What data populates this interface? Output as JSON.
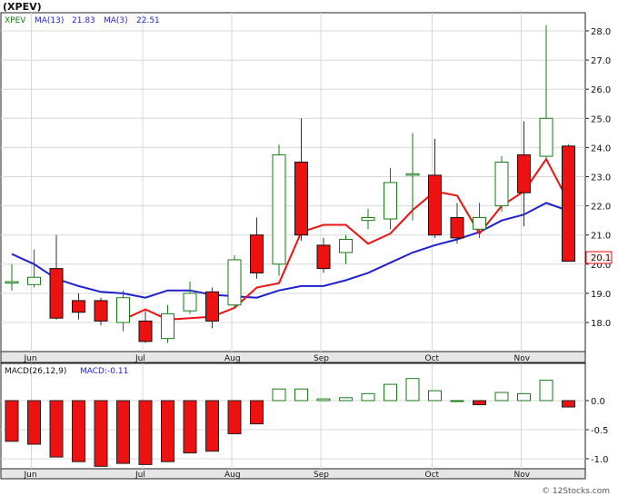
{
  "ticker_title": "(XPEV)",
  "legend": {
    "symbol": "XPEV",
    "ma13_label": "MA(13)",
    "ma13_value": "21.83",
    "ma3_label": "MA(3)",
    "ma3_value": "22.51",
    "macd_label": "MACD(26,12,9)",
    "macd_value_label": "MACD:-0.11"
  },
  "last_price_label": "20.1",
  "watermark": "© 12Stocks.com",
  "colors": {
    "up_body": "#ffffff",
    "up_outline": "#1a7a1a",
    "down_body": "#ee1111",
    "down_outline": "#111111",
    "wick": "#333333",
    "ma13": "#1f1fcf",
    "ma3": "#ee1111",
    "grid": "#d8d8d8",
    "frame": "#222222",
    "hist_pos_outline": "#1a7a1a",
    "hist_neg": "#ee1111",
    "price_box": "#ffeeee"
  },
  "chart_data": [
    {
      "type": "candlestick",
      "title": "(XPEV)",
      "x_labels": [
        "Jun",
        "Jul",
        "Aug",
        "Sep",
        "Oct",
        "Nov"
      ],
      "y_ticks": [
        "18.0",
        "19.0",
        "20.0",
        "21.0",
        "22.0",
        "23.0",
        "24.0",
        "25.0",
        "26.0",
        "27.0",
        "28.0"
      ],
      "ylim": [
        17.0,
        28.5
      ],
      "grid": true,
      "periods": 26,
      "month_starts": [
        1,
        6,
        10,
        14,
        19,
        23
      ],
      "candles": [
        {
          "o": 19.35,
          "h": 20.0,
          "l": 19.1,
          "c": 19.4
        },
        {
          "o": 19.3,
          "h": 20.5,
          "l": 19.2,
          "c": 19.55
        },
        {
          "o": 19.85,
          "h": 21.0,
          "l": 18.1,
          "c": 18.15
        },
        {
          "o": 18.75,
          "h": 19.0,
          "l": 18.1,
          "c": 18.35
        },
        {
          "o": 18.75,
          "h": 18.85,
          "l": 17.9,
          "c": 18.05
        },
        {
          "o": 18.0,
          "h": 19.1,
          "l": 17.7,
          "c": 18.85
        },
        {
          "o": 18.05,
          "h": 18.4,
          "l": 17.3,
          "c": 17.35
        },
        {
          "o": 17.45,
          "h": 18.6,
          "l": 17.3,
          "c": 18.3
        },
        {
          "o": 18.4,
          "h": 19.4,
          "l": 18.3,
          "c": 19.0
        },
        {
          "o": 19.05,
          "h": 19.2,
          "l": 17.8,
          "c": 18.05
        },
        {
          "o": 18.6,
          "h": 20.3,
          "l": 18.5,
          "c": 20.15
        },
        {
          "o": 21.0,
          "h": 21.6,
          "l": 19.5,
          "c": 19.7
        },
        {
          "o": 20.0,
          "h": 24.1,
          "l": 19.6,
          "c": 23.75
        },
        {
          "o": 23.5,
          "h": 25.0,
          "l": 20.8,
          "c": 21.0
        },
        {
          "o": 20.65,
          "h": 20.9,
          "l": 19.7,
          "c": 19.85
        },
        {
          "o": 20.4,
          "h": 21.0,
          "l": 20.0,
          "c": 20.85
        },
        {
          "o": 21.5,
          "h": 21.9,
          "l": 21.2,
          "c": 21.6
        },
        {
          "o": 21.55,
          "h": 23.3,
          "l": 21.2,
          "c": 22.8
        },
        {
          "o": 23.05,
          "h": 24.5,
          "l": 21.5,
          "c": 23.1
        },
        {
          "o": 23.05,
          "h": 24.3,
          "l": 20.9,
          "c": 21.0
        },
        {
          "o": 21.6,
          "h": 22.1,
          "l": 20.7,
          "c": 20.9
        },
        {
          "o": 21.2,
          "h": 22.1,
          "l": 20.9,
          "c": 21.6
        },
        {
          "o": 22.0,
          "h": 23.7,
          "l": 21.8,
          "c": 23.5
        },
        {
          "o": 23.75,
          "h": 24.9,
          "l": 21.3,
          "c": 22.45
        },
        {
          "o": 23.7,
          "h": 28.2,
          "l": 23.6,
          "c": 25.0
        },
        {
          "o": 24.05,
          "h": 24.1,
          "l": 20.1,
          "c": 20.1
        }
      ],
      "ma13": [
        null,
        null,
        null,
        null,
        null,
        18.1,
        18.45,
        18.1,
        18.15,
        18.2,
        18.5,
        19.2,
        19.35,
        21.1,
        21.35,
        21.35,
        20.7,
        21.05,
        21.85,
        22.5,
        22.35,
        21.05,
        22.0,
        22.5,
        23.6,
        22.15
      ],
      "ma3": [
        20.35,
        20.0,
        19.5,
        19.25,
        19.05,
        19.0,
        18.85,
        19.1,
        19.1,
        18.95,
        18.9,
        18.85,
        19.1,
        19.25,
        19.25,
        19.45,
        19.7,
        20.05,
        20.4,
        20.65,
        20.85,
        21.1,
        21.5,
        21.7,
        22.1,
        21.83
      ]
    },
    {
      "type": "bar",
      "title": "MACD(26,12,9)",
      "y_ticks": [
        "-1.0",
        "-0.5",
        "0.0"
      ],
      "ylim": [
        -1.15,
        0.45
      ],
      "values": [
        -0.7,
        -0.75,
        -0.97,
        -1.05,
        -1.13,
        -1.08,
        -1.1,
        -1.05,
        -0.9,
        -0.87,
        -0.57,
        -0.4,
        0.2,
        0.2,
        0.03,
        0.05,
        0.12,
        0.28,
        0.38,
        0.17,
        0.0,
        -0.07,
        0.14,
        0.12,
        0.35,
        -0.11
      ]
    }
  ]
}
